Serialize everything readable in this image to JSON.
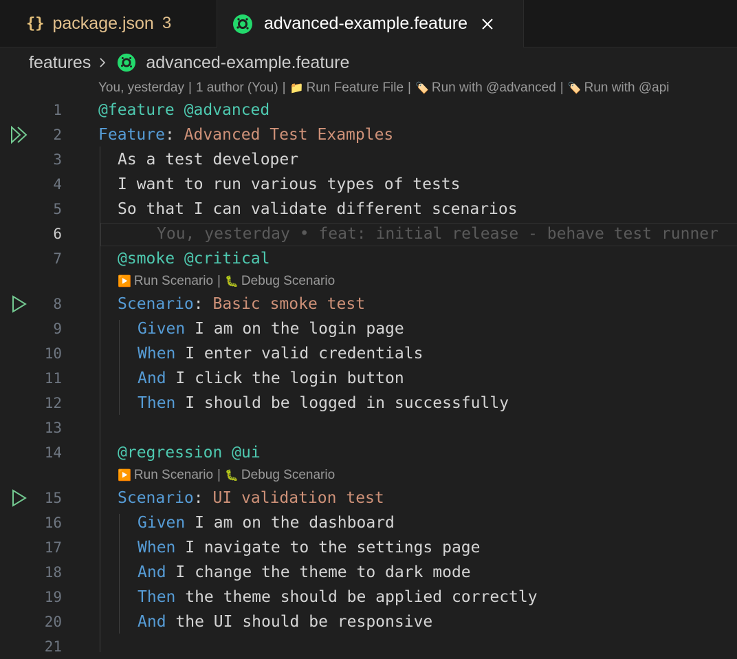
{
  "tabs": [
    {
      "label": "package.json",
      "count": "3",
      "icon": "braces-icon",
      "active": false
    },
    {
      "label": "advanced-example.feature",
      "icon": "cucumber-icon",
      "active": true
    }
  ],
  "breadcrumb": {
    "folder": "features",
    "file": "advanced-example.feature"
  },
  "codelens": {
    "header": {
      "author": "You, yesterday",
      "authors": "1 author (You)",
      "run_feature": "Run Feature File",
      "run_advanced": "Run with @advanced",
      "run_api": "Run with @api"
    },
    "scenario1": {
      "run": "Run Scenario",
      "debug": "Debug Scenario"
    },
    "scenario2": {
      "run": "Run Scenario",
      "debug": "Debug Scenario"
    }
  },
  "blame": "You, yesterday • feat: initial release - behave test runner",
  "lines": {
    "n1": "1",
    "n2": "2",
    "n3": "3",
    "n4": "4",
    "n5": "5",
    "n6": "6",
    "n7": "7",
    "n8": "8",
    "n9": "9",
    "n10": "10",
    "n11": "11",
    "n12": "12",
    "n13": "13",
    "n14": "14",
    "n15": "15",
    "n16": "16",
    "n17": "17",
    "n18": "18",
    "n19": "19",
    "n20": "20",
    "n21": "21",
    "l1": "@feature @advanced",
    "l2_kw": "Feature",
    "l2_colon": ": ",
    "l2_title": "Advanced Test Examples",
    "l3": "As a test developer",
    "l4": "I want to run various types of tests",
    "l5": "So that I can validate different scenarios",
    "l7": "@smoke @critical",
    "l8_kw": "Scenario",
    "l8_colon": ": ",
    "l8_title": "Basic smoke test",
    "l9_kw": "Given",
    "l9": " I am on the login page",
    "l10_kw": "When",
    "l10": " I enter valid credentials",
    "l11_kw": "And",
    "l11": " I click the login button",
    "l12_kw": "Then",
    "l12": " I should be logged in successfully",
    "l14": "@regression @ui",
    "l15_kw": "Scenario",
    "l15_colon": ": ",
    "l15_title": "UI validation test",
    "l16_kw": "Given",
    "l16": " I am on the dashboard",
    "l17_kw": "When",
    "l17": " I navigate to the settings page",
    "l18_kw": "And",
    "l18": " I change the theme to dark mode",
    "l19_kw": "Then",
    "l19": " the theme should be applied correctly",
    "l20_kw": "And",
    "l20": " the UI should be responsive"
  },
  "colors": {
    "keyword": "#569cd6",
    "title": "#ce9178",
    "tag": "#4ec9b0",
    "run_icon": "#73c991"
  }
}
